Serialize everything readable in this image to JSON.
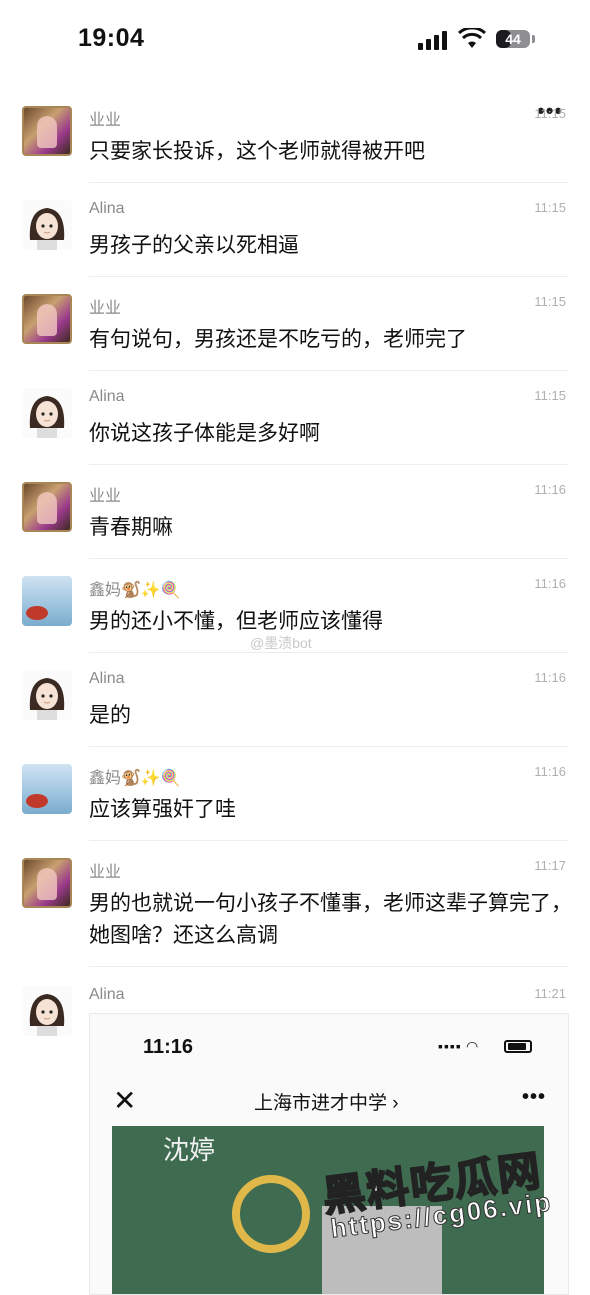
{
  "status_bar": {
    "time": "19:04",
    "battery": "44"
  },
  "nav": {
    "back_icon": "‹",
    "more_icon": "•••"
  },
  "messages": [
    {
      "sender": "业业",
      "time": "11:15",
      "text": "只要家长投诉，这个老师就得被开吧"
    },
    {
      "sender": "Alina",
      "time": "11:15",
      "text": "男孩子的父亲以死相逼"
    },
    {
      "sender": "业业",
      "time": "11:15",
      "text": "有句说句，男孩还是不吃亏的，老师完了"
    },
    {
      "sender": "Alina",
      "time": "11:15",
      "text": "你说这孩子体能是多好啊"
    },
    {
      "sender": "业业",
      "time": "11:16",
      "text": "青春期嘛"
    },
    {
      "sender": "鑫妈🐒✨🍭",
      "time": "11:16",
      "text": "男的还小不懂，但老师应该懂得"
    },
    {
      "sender": "Alina",
      "time": "11:16",
      "text": "是的"
    },
    {
      "sender": "鑫妈🐒✨🍭",
      "time": "11:16",
      "text": "应该算强奸了哇"
    },
    {
      "sender": "业业",
      "time": "11:17",
      "text": "男的也就说一句小孩子不懂事，老师这辈子算完了，她图啥？还这么高调"
    },
    {
      "sender": "Alina",
      "time": "11:21",
      "text": ""
    }
  ],
  "mid_watermark": "@墨渍bot",
  "card": {
    "time": "11:16",
    "close_icon": "✕",
    "title": "上海市进才中学 ›",
    "more_icon": "•••",
    "board_name": "沈婷"
  },
  "watermark": {
    "text": "黑料吃瓜网",
    "url": "https://cg06.vip"
  }
}
